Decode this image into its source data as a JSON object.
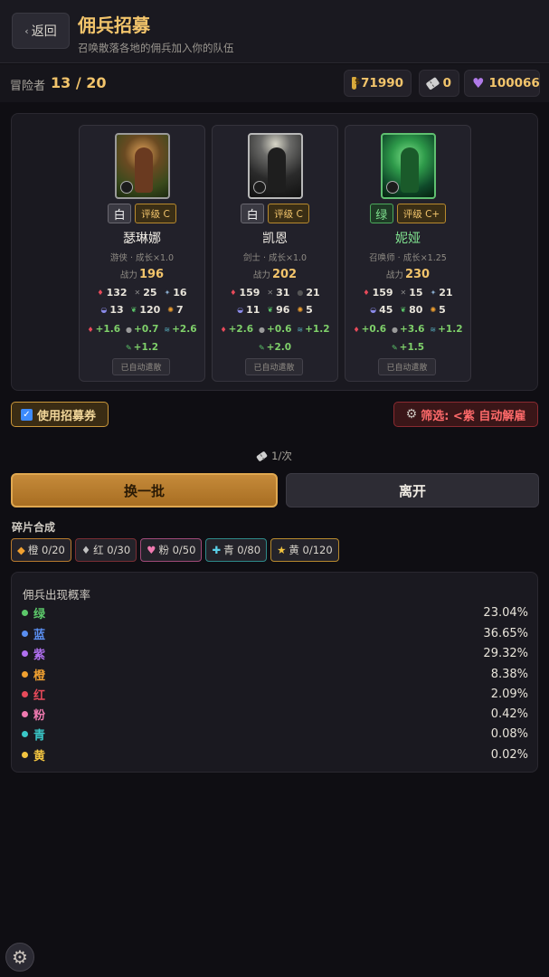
{
  "header": {
    "back_label": "返回",
    "title": "佣兵招募",
    "subtitle": "召唤散落各地的佣兵加入你的队伍"
  },
  "statbar": {
    "adventurer_label": "冒险者",
    "adventurer_count": "13 / 20",
    "gold": "71990",
    "tickets": "0",
    "hearts": "100066"
  },
  "cards": [
    {
      "rarity": "白",
      "grade": "评级 C",
      "name": "瑟琳娜",
      "meta": "游侠 · 成长×1.0",
      "power_label": "战力",
      "power": "196",
      "stats1": [
        "132",
        "25",
        "16"
      ],
      "stats2": [
        "13",
        "120",
        "7"
      ],
      "bonus1": [
        "+1.6",
        "+0.7",
        "+2.6"
      ],
      "bonus2": "+1.2",
      "auto_label": "已自动遣散"
    },
    {
      "rarity": "白",
      "grade": "评级 C",
      "name": "凯恩",
      "meta": "剑士 · 成长×1.0",
      "power_label": "战力",
      "power": "202",
      "stats1": [
        "159",
        "31",
        "21"
      ],
      "stats2": [
        "11",
        "96",
        "5"
      ],
      "bonus1": [
        "+2.6",
        "+0.6",
        "+1.2"
      ],
      "bonus2": "+2.0",
      "auto_label": "已自动遣散"
    },
    {
      "rarity": "绿",
      "grade": "评级 C+",
      "name": "妮娅",
      "meta": "召唤师 · 成长×1.25",
      "power_label": "战力",
      "power": "230",
      "stats1": [
        "159",
        "15",
        "21"
      ],
      "stats2": [
        "45",
        "80",
        "5"
      ],
      "bonus1": [
        "+0.6",
        "+3.6",
        "+1.2"
      ],
      "bonus2": "+1.5",
      "auto_label": "已自动遣散"
    }
  ],
  "options": {
    "use_ticket_label": "使用招募券",
    "filter_label": "筛选: <紫 自动解雇"
  },
  "cost_label": "1/次",
  "buttons": {
    "refresh": "换一批",
    "leave": "离开"
  },
  "shards": {
    "title": "碎片合成",
    "items": [
      {
        "label": "橙 0/20",
        "icon": "◆",
        "color": "#f0a030"
      },
      {
        "label": "红 0/30",
        "icon": "♦",
        "color": "#c0c0c0"
      },
      {
        "label": "粉 0/50",
        "icon": "♥",
        "color": "#f07ab0"
      },
      {
        "label": "青 0/80",
        "icon": "✚",
        "color": "#5ad0e8"
      },
      {
        "label": "黄 0/120",
        "icon": "★",
        "color": "#f2c440"
      }
    ]
  },
  "probability": {
    "title": "佣兵出现概率",
    "rows": [
      {
        "label": "绿",
        "value": "23.04%",
        "color": "#5cc86a"
      },
      {
        "label": "蓝",
        "value": "36.65%",
        "color": "#5a8ef0"
      },
      {
        "label": "紫",
        "value": "29.32%",
        "color": "#b070f0"
      },
      {
        "label": "橙",
        "value": "8.38%",
        "color": "#f0a030"
      },
      {
        "label": "红",
        "value": "2.09%",
        "color": "#e84a5a"
      },
      {
        "label": "粉",
        "value": "0.42%",
        "color": "#f07ab0"
      },
      {
        "label": "青",
        "value": "0.08%",
        "color": "#3ac8c8"
      },
      {
        "label": "黄",
        "value": "0.02%",
        "color": "#f2c440"
      }
    ]
  }
}
